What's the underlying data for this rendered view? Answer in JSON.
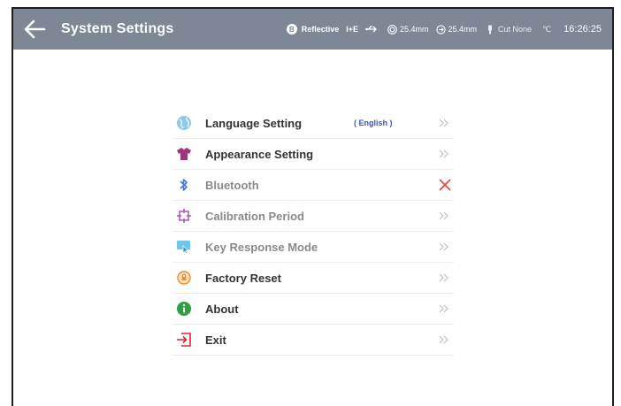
{
  "header": {
    "title": "System Settings",
    "status": {
      "mode_badge": "B",
      "mode": "Reflective",
      "polarity": "I+E",
      "width": "25.4mm",
      "length": "25.4mm",
      "cut": "Cut None",
      "temp": "℃",
      "time": "16:26:25"
    }
  },
  "menu": {
    "items": [
      {
        "label": "Language Setting",
        "value": "( English )"
      },
      {
        "label": "Appearance Setting"
      },
      {
        "label": "Bluetooth"
      },
      {
        "label": "Calibration Period"
      },
      {
        "label": "Key Response Mode"
      },
      {
        "label": "Factory Reset"
      },
      {
        "label": "About"
      },
      {
        "label": "Exit"
      }
    ]
  },
  "colors": {
    "topbar": "#7d8795",
    "accent_blue": "#3b57c4",
    "bluetooth_off": "#e24b4b"
  },
  "icons": [
    "back-arrow-icon",
    "globe-icon",
    "shirt-icon",
    "bluetooth-icon",
    "crosshair-icon",
    "touch-icon",
    "reset-icon",
    "info-icon",
    "exit-icon",
    "chevron-double-right-icon",
    "close-icon"
  ]
}
